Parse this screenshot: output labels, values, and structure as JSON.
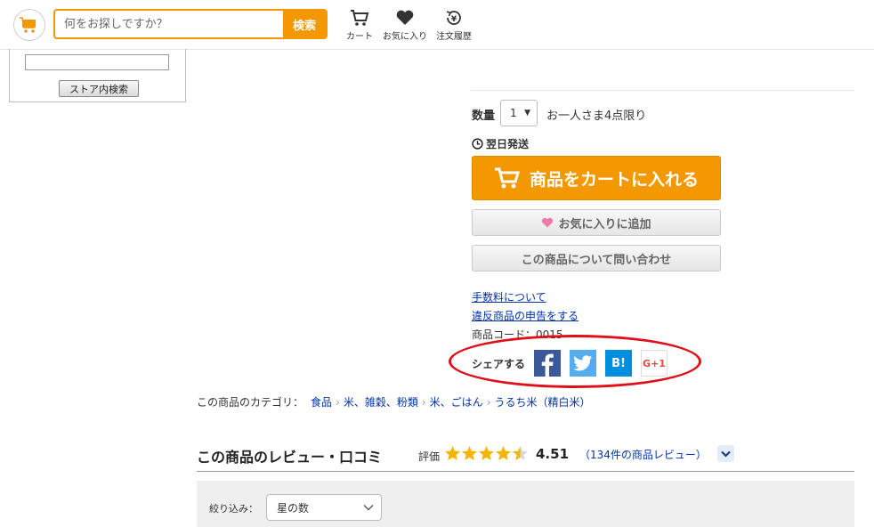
{
  "header": {
    "search_placeholder": "何をお探しですか？",
    "search_button": "検索",
    "nav": [
      {
        "label": "カート",
        "icon": "cart-icon"
      },
      {
        "label": "お気に入り",
        "icon": "heart-icon"
      },
      {
        "label": "注文履歴",
        "icon": "order-history-icon"
      }
    ]
  },
  "store_search": {
    "button": "ストア内検索"
  },
  "purchase": {
    "qty_label": "数量",
    "qty_value": "1",
    "qty_limit": "お一人さま4点限り",
    "shipping": "翌日発送",
    "cart_button": "商品をカートに入れる",
    "favorite_button": "お気に入りに追加",
    "inquiry_button": "この商品について問い合わせ",
    "links": [
      "手数料について",
      "違反商品の申告をする"
    ],
    "product_code": "商品コード：0015",
    "share_label": "シェアする",
    "share_buttons": [
      {
        "name": "facebook",
        "text": "f",
        "color": "#3b5998"
      },
      {
        "name": "twitter",
        "text": "",
        "color": "#55acee"
      },
      {
        "name": "hatena",
        "text": "B!",
        "color": "#008fde"
      },
      {
        "name": "google-plus",
        "text": "G+1",
        "color": "#dd4b39"
      }
    ],
    "highlight_color": "#e0101a"
  },
  "category": {
    "label": "この商品のカテゴリ：",
    "items": [
      "食品",
      "米、雑穀、粉類",
      "米、ごはん",
      "うるち米（精白米）"
    ]
  },
  "reviews": {
    "title": "この商品のレビュー・口コミ",
    "eval_label": "評価",
    "rating": 4.51,
    "score": "4.51",
    "count_text": "（134件の商品レビュー）",
    "filter_label": "絞り込み：",
    "filter_value": "星の数"
  },
  "colors": {
    "accent": "#f39800",
    "link": "#0033aa",
    "star": "#f5b400"
  }
}
